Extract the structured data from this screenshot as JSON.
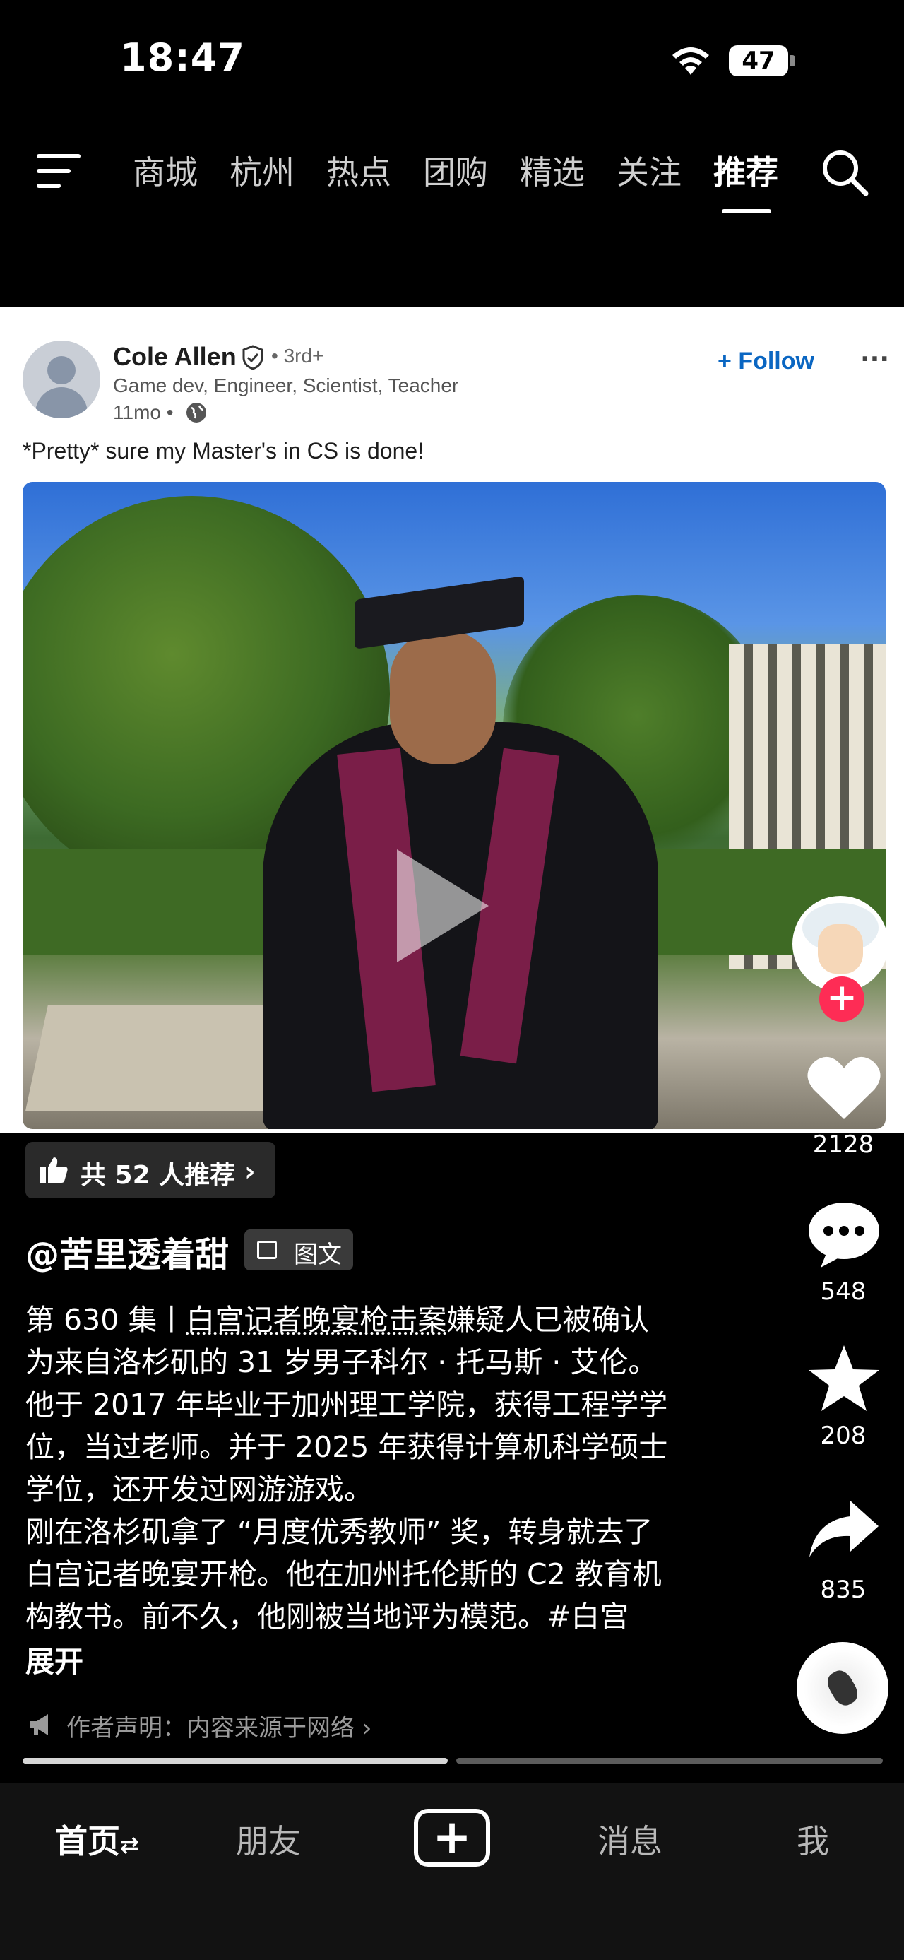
{
  "status_bar": {
    "time": "18:47",
    "battery": "47"
  },
  "top_nav": {
    "tabs": [
      "商城",
      "杭州",
      "热点",
      "团购",
      "精选",
      "关注",
      "推荐"
    ],
    "active_index": 6
  },
  "post": {
    "author": "Cole Allen",
    "degree": "• 3rd+",
    "headline": "Game dev, Engineer, Scientist,  Teacher",
    "posted": "11mo •",
    "follow_label": "Follow",
    "more_label": "···",
    "text": "*Pretty* sure my Master's in CS is done!"
  },
  "right_rail": {
    "likes": "2128",
    "comments": "548",
    "favorites": "208",
    "shares": "835"
  },
  "info": {
    "recommend": "共 52 人推荐",
    "author_handle": "@苦里透着甜",
    "tag": "图文",
    "caption": {
      "prefix": "第 630 集丨",
      "link": "白宫记者晚宴枪击案",
      "line1_rest": "嫌疑人已被确认",
      "line2": "为来自洛杉矶的 31 岁男子科尔 · 托马斯 · 艾伦。",
      "line3": "他于 2017 年毕业于加州理工学院，获得工程学学",
      "line4": "位，当过老师。并于 2025 年获得计算机科学硕士",
      "line5": "学位，还开发过网游游戏。",
      "line6": "刚在洛杉矶拿了 “月度优秀教师” 奖，转身就去了",
      "line7": "白宫记者晚宴开枪。他在加州托伦斯的 C2 教育机",
      "line8": "构教书。前不久，他刚被当地评为模范。#白宫"
    },
    "expand": "展开",
    "disclaimer": "作者声明：内容来源于网络 ›",
    "progress": 0.5
  },
  "bottom_nav": {
    "home": "首页",
    "home_suffix": "⇄",
    "friends": "朋友",
    "messages": "消息",
    "me": "我"
  }
}
